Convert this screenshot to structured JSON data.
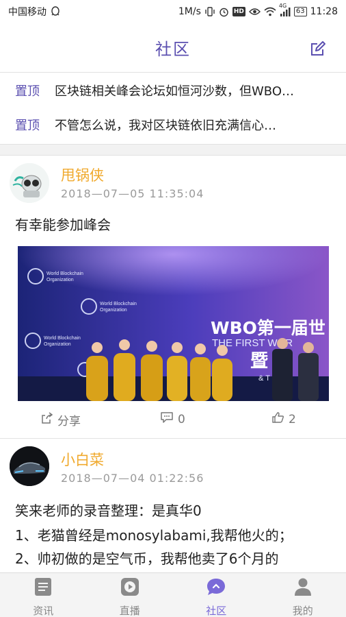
{
  "status_bar": {
    "carrier": "中国移动",
    "net_speed": "1M/s",
    "network": "4G",
    "battery": "63",
    "time": "11:28",
    "hd_badge": "HD",
    "icons": [
      "qq-penguin-icon",
      "vibrate-icon",
      "alarm-icon",
      "hd-icon",
      "eye-icon",
      "wifi-icon",
      "signal-icon",
      "battery-icon"
    ]
  },
  "header": {
    "title": "社区",
    "compose_icon": "edit-icon"
  },
  "pinned": [
    {
      "tag": "置顶",
      "text": "区块链相关峰会论坛如恒河沙数，但WBO…"
    },
    {
      "tag": "置顶",
      "text": "不管怎么说，我对区块链依旧充满信心…"
    }
  ],
  "posts": [
    {
      "username": "甩锅侠",
      "timestamp": "2018—07—05 11:35:04",
      "text": "有幸能参加峰会",
      "image": {
        "org_name_line1": "World Blockchain",
        "org_name_line2": "Organization",
        "banner_main": "WBO第一届世",
        "banner_sub": "THE FIRST WOR",
        "banner_tail": "暨",
        "banner_amp": "& T"
      },
      "share_label": "分享",
      "comments": "0",
      "likes": "2"
    },
    {
      "username": "小白菜",
      "timestamp": "2018—07—04 01:22:56",
      "lines": [
        "笑来老师的录音整理：是真华0",
        "1、老猫曾经是monosylabami,我帮他火的；",
        "2、帅初做的是空气币，我帮他卖了6个月的"
      ]
    }
  ],
  "bottom_nav": [
    {
      "label": "资讯",
      "icon": "news-icon"
    },
    {
      "label": "直播",
      "icon": "play-icon"
    },
    {
      "label": "社区",
      "icon": "chat-bubble-icon",
      "active": true
    },
    {
      "label": "我的",
      "icon": "profile-icon"
    }
  ],
  "colors": {
    "accent": "#5b4fb0",
    "username": "#f0a92c",
    "nav_active": "#7a6ad8",
    "nav_inactive": "#888888"
  }
}
